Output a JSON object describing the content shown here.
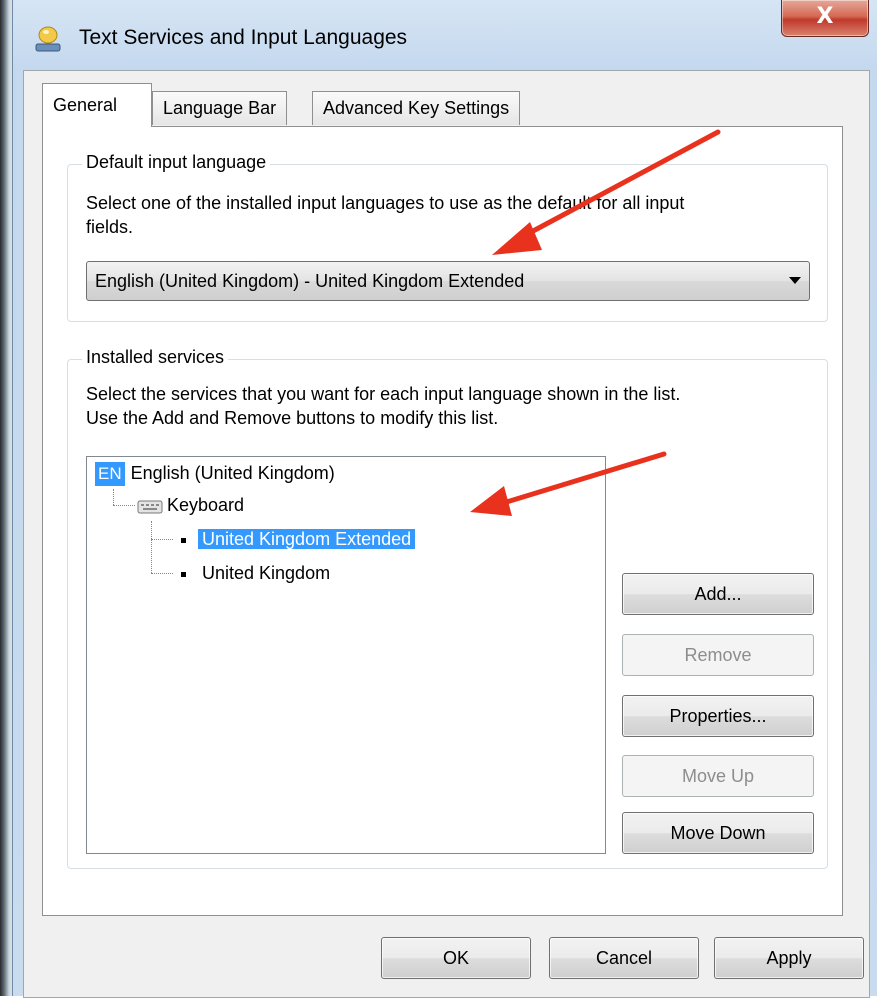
{
  "window": {
    "title": "Text Services and Input Languages",
    "close_label": "X"
  },
  "tabs": [
    {
      "label": "General",
      "active": true
    },
    {
      "label": "Language Bar",
      "active": false
    },
    {
      "label": "Advanced Key Settings",
      "active": false
    }
  ],
  "default_input_language": {
    "legend": "Default input language",
    "description_line1": "Select one of the installed input languages to use as the default for all input",
    "description_line2": "fields.",
    "selected_value": "English (United Kingdom) - United Kingdom Extended"
  },
  "installed_services": {
    "legend": "Installed services",
    "description_line1": "Select the services that you want for each input language shown in the list.",
    "description_line2": "Use the Add and Remove buttons to modify this list.",
    "tree": {
      "language_code": "EN",
      "language": "English (United Kingdom)",
      "category": "Keyboard",
      "items": [
        {
          "label": "United Kingdom Extended",
          "selected": true
        },
        {
          "label": "United Kingdom",
          "selected": false
        }
      ]
    },
    "buttons": {
      "add": "Add...",
      "remove": "Remove",
      "properties": "Properties...",
      "move_up": "Move Up",
      "move_down": "Move Down"
    }
  },
  "footer": {
    "ok": "OK",
    "cancel": "Cancel",
    "apply": "Apply"
  },
  "colors": {
    "selection": "#3399ff",
    "annotation_arrow": "#e8321e",
    "close_button": "#c0392b"
  },
  "icons": [
    "language-bar-icon",
    "keyboard-icon",
    "dropdown-arrow-icon",
    "close-icon",
    "annotation-arrow"
  ]
}
